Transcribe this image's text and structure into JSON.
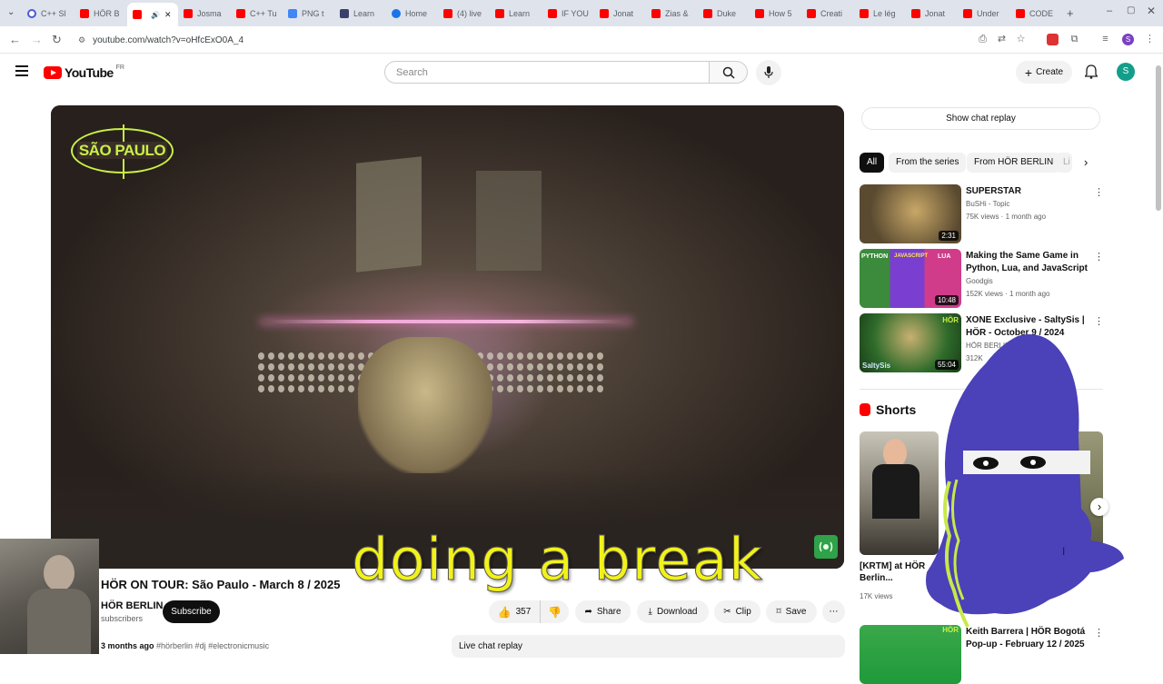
{
  "browser": {
    "tabs": [
      {
        "label": "C++ Sl",
        "icon": "g"
      },
      {
        "label": "HÖR B",
        "icon": "yt"
      },
      {
        "label": "",
        "icon": "yt",
        "active": true
      },
      {
        "label": "Josma",
        "icon": "yt"
      },
      {
        "label": "C++ Tu",
        "icon": "yt"
      },
      {
        "label": "PNG t",
        "icon": "doc"
      },
      {
        "label": "Learn",
        "icon": "tmp"
      },
      {
        "label": "Home",
        "icon": "blue"
      },
      {
        "label": "(4) live",
        "icon": "yt"
      },
      {
        "label": "Learn",
        "icon": "yt"
      },
      {
        "label": "IF YOU",
        "icon": "yt"
      },
      {
        "label": "Jonat",
        "icon": "yt"
      },
      {
        "label": "Zias &",
        "icon": "yt"
      },
      {
        "label": "Duke",
        "icon": "yt"
      },
      {
        "label": "How 5",
        "icon": "yt"
      },
      {
        "label": "Creati",
        "icon": "yt"
      },
      {
        "label": "Le lég",
        "icon": "yt"
      },
      {
        "label": "Jonat",
        "icon": "yt"
      },
      {
        "label": "Under",
        "icon": "yt"
      },
      {
        "label": "CODE",
        "icon": "yt"
      }
    ],
    "url": "youtube.com/watch?v=oHfcExO0A_4"
  },
  "youtube": {
    "logo_text": "YouTube",
    "region": "FR",
    "search_placeholder": "Search",
    "create_label": "Create",
    "avatar_letter": "S"
  },
  "video": {
    "overlay_logo": "SÃO PAULO",
    "subtitle": "doing a break",
    "title": "HÖR ON TOUR: São Paulo - March 8 / 2025",
    "channel": "HÖR BERLIN",
    "subscribers_text": "subscribers",
    "subscribe_label": "Subscribe",
    "likes": "357",
    "share_label": "Share",
    "download_label": "Download",
    "clip_label": "Clip",
    "save_label": "Save",
    "age": "3 months ago",
    "tags": "#hörberlin #dj #electronicmusic",
    "live_chat_label": "Live chat replay"
  },
  "sidebar": {
    "show_chat_label": "Show chat replay",
    "chips": [
      "All",
      "From the series",
      "From HÖR BERLIN",
      "Li"
    ],
    "videos": [
      {
        "title": "SUPERSTAR",
        "channel": "BuSHi - Topic",
        "stats": "75K views · 1 month ago",
        "duration": "2:31",
        "thumb": "#7a6a48"
      },
      {
        "title": "Making the Same Game in Python, Lua, and JavaScript",
        "channel": "Goodgis",
        "stats": "152K views · 1 month ago",
        "duration": "10:48",
        "thumb": "#8a3fd0"
      },
      {
        "title": "XONE Exclusive - SaltySis | HÖR - October 9 / 2024",
        "channel": "HÖR BERLIN",
        "stats": "312K",
        "duration": "55:04",
        "thumb": "#2e6b2a"
      }
    ],
    "shorts_label": "Shorts",
    "short_views": "17K views",
    "short_title": "[KRTM] at HÖR Berlin...",
    "bottom_video": {
      "title": "Keith Barrera | HÖR Bogotá Pop-up - February 12 / 2025",
      "thumb": "#1f9a3a"
    }
  }
}
